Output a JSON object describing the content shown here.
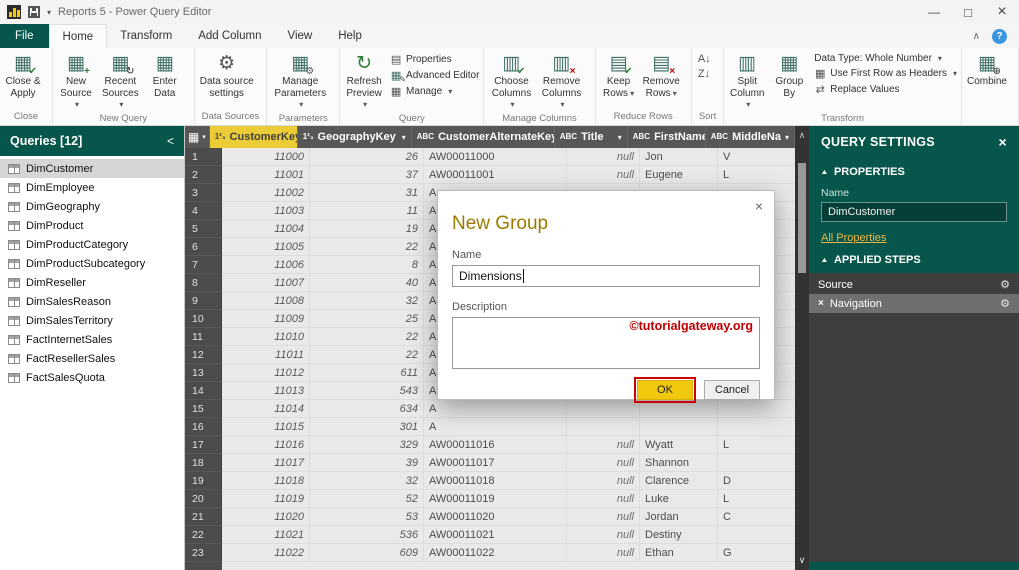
{
  "titlebar": {
    "title": "Reports 5 - Power Query Editor"
  },
  "tabs": [
    {
      "label": "File",
      "file": true
    },
    {
      "label": "Home",
      "active": true
    },
    {
      "label": "Transform"
    },
    {
      "label": "Add Column"
    },
    {
      "label": "View"
    },
    {
      "label": "Help"
    }
  ],
  "ribbon": {
    "groups": [
      {
        "caption": "Close",
        "big": [
          {
            "label1": "Close &",
            "label2": "Apply",
            "icon": "close-apply"
          }
        ]
      },
      {
        "caption": "New Query",
        "big": [
          {
            "label1": "New",
            "label2": "Source",
            "icon": "new-source",
            "dropdown": true
          },
          {
            "label1": "Recent",
            "label2": "Sources",
            "icon": "recent-sources",
            "dropdown": true
          },
          {
            "label1": "Enter",
            "label2": "Data",
            "icon": "enter-data"
          }
        ]
      },
      {
        "caption": "Data Sources",
        "big": [
          {
            "label1": "Data source",
            "label2": "settings",
            "icon": "datasource-settings"
          }
        ]
      },
      {
        "caption": "Parameters",
        "big": [
          {
            "label1": "Manage",
            "label2": "Parameters",
            "icon": "manage-parameters",
            "dropdown": true
          }
        ]
      },
      {
        "caption": "Query",
        "big": [
          {
            "label1": "Refresh",
            "label2": "Preview",
            "icon": "refresh",
            "dropdown": true
          }
        ],
        "small": [
          {
            "label": "Properties",
            "icon": "properties"
          },
          {
            "label": "Advanced Editor",
            "icon": "advanced-editor"
          },
          {
            "label": "Manage",
            "icon": "manage",
            "dropdown": true
          }
        ]
      },
      {
        "caption": "Manage Columns",
        "big": [
          {
            "label1": "Choose",
            "label2": "Columns",
            "icon": "choose-columns",
            "dropdown": true
          },
          {
            "label1": "Remove",
            "label2": "Columns",
            "icon": "remove-columns",
            "dropdown": true
          }
        ]
      },
      {
        "caption": "Reduce Rows",
        "big": [
          {
            "label1": "Keep",
            "label2": "Rows",
            "icon": "keep-rows",
            "dropdown": true
          },
          {
            "label1": "Remove",
            "label2": "Rows",
            "icon": "remove-rows",
            "dropdown": true
          }
        ]
      },
      {
        "caption": "Sort",
        "small": [
          {
            "label": "",
            "icon": "sort-az"
          },
          {
            "label": "",
            "icon": "sort-za"
          }
        ]
      },
      {
        "caption": "Transform",
        "big": [
          {
            "label1": "Split",
            "label2": "Column",
            "icon": "split-column",
            "dropdown": true
          },
          {
            "label1": "Group",
            "label2": "By",
            "icon": "group-by"
          }
        ],
        "small": [
          {
            "label": "Data Type: Whole Number",
            "dropdown": true
          },
          {
            "label": "Use First Row as Headers",
            "icon": "first-row-headers",
            "dropdown": true
          },
          {
            "label": "Replace Values",
            "icon": "replace-values"
          }
        ]
      },
      {
        "caption": "",
        "big": [
          {
            "label1": "Combine",
            "label2": "",
            "icon": "combine"
          }
        ]
      }
    ]
  },
  "queries": {
    "title": "Queries [12]",
    "items": [
      {
        "label": "DimCustomer",
        "selected": true
      },
      {
        "label": "DimEmployee"
      },
      {
        "label": "DimGeography"
      },
      {
        "label": "DimProduct"
      },
      {
        "label": "DimProductCategory"
      },
      {
        "label": "DimProductSubcategory"
      },
      {
        "label": "DimReseller"
      },
      {
        "label": "DimSalesReason"
      },
      {
        "label": "DimSalesTerritory"
      },
      {
        "label": "FactInternetSales"
      },
      {
        "label": "FactResellerSales"
      },
      {
        "label": "FactSalesQuota"
      }
    ]
  },
  "table": {
    "columns": [
      {
        "name": "CustomerKey",
        "type": "number",
        "selected": true
      },
      {
        "name": "GeographyKey",
        "type": "number"
      },
      {
        "name": "CustomerAlternateKey",
        "type": "text"
      },
      {
        "name": "Title",
        "type": "text"
      },
      {
        "name": "FirstName",
        "type": "text"
      },
      {
        "name": "MiddleNa",
        "type": "text"
      }
    ],
    "rows": [
      {
        "n": "1",
        "key": "11000",
        "geo": "26",
        "alt": "AW00011000",
        "title": "null",
        "first": "Jon",
        "middle": "V"
      },
      {
        "n": "2",
        "key": "11001",
        "geo": "37",
        "alt": "AW00011001",
        "title": "null",
        "first": "Eugene",
        "middle": "L"
      },
      {
        "n": "3",
        "key": "11002",
        "geo": "31",
        "alt": "A"
      },
      {
        "n": "4",
        "key": "11003",
        "geo": "11",
        "alt": "A"
      },
      {
        "n": "5",
        "key": "11004",
        "geo": "19",
        "alt": "A"
      },
      {
        "n": "6",
        "key": "11005",
        "geo": "22",
        "alt": "A"
      },
      {
        "n": "7",
        "key": "11006",
        "geo": "8",
        "alt": "A"
      },
      {
        "n": "8",
        "key": "11007",
        "geo": "40",
        "alt": "A"
      },
      {
        "n": "9",
        "key": "11008",
        "geo": "32",
        "alt": "A"
      },
      {
        "n": "10",
        "key": "11009",
        "geo": "25",
        "alt": "A"
      },
      {
        "n": "11",
        "key": "11010",
        "geo": "22",
        "alt": "A"
      },
      {
        "n": "12",
        "key": "11011",
        "geo": "22",
        "alt": "A"
      },
      {
        "n": "13",
        "key": "11012",
        "geo": "611",
        "alt": "A"
      },
      {
        "n": "14",
        "key": "11013",
        "geo": "543",
        "alt": "A"
      },
      {
        "n": "15",
        "key": "11014",
        "geo": "634",
        "alt": "A"
      },
      {
        "n": "16",
        "key": "11015",
        "geo": "301",
        "alt": "A"
      },
      {
        "n": "17",
        "key": "11016",
        "geo": "329",
        "alt": "AW00011016",
        "title": "null",
        "first": "Wyatt",
        "middle": "L"
      },
      {
        "n": "18",
        "key": "11017",
        "geo": "39",
        "alt": "AW00011017",
        "title": "null",
        "first": "Shannon",
        "middle": ""
      },
      {
        "n": "19",
        "key": "11018",
        "geo": "32",
        "alt": "AW00011018",
        "title": "null",
        "first": "Clarence",
        "middle": "D"
      },
      {
        "n": "20",
        "key": "11019",
        "geo": "52",
        "alt": "AW00011019",
        "title": "null",
        "first": "Luke",
        "middle": "L"
      },
      {
        "n": "21",
        "key": "11020",
        "geo": "53",
        "alt": "AW00011020",
        "title": "null",
        "first": "Jordan",
        "middle": "C"
      },
      {
        "n": "22",
        "key": "11021",
        "geo": "536",
        "alt": "AW00011021",
        "title": "null",
        "first": "Destiny",
        "middle": ""
      },
      {
        "n": "23",
        "key": "11022",
        "geo": "609",
        "alt": "AW00011022",
        "title": "null",
        "first": "Ethan",
        "middle": "G"
      }
    ]
  },
  "dialog": {
    "title": "New Group",
    "name_label": "Name",
    "name_value": "Dimensions",
    "description_label": "Description",
    "watermark": "©tutorialgateway.org",
    "ok_label": "OK",
    "cancel_label": "Cancel"
  },
  "query_settings": {
    "title": "QUERY SETTINGS",
    "properties_label": "PROPERTIES",
    "name_label": "Name",
    "name_value": "DimCustomer",
    "all_properties_label": "All Properties",
    "applied_steps_label": "APPLIED STEPS",
    "steps": [
      {
        "label": "Source"
      },
      {
        "label": "Navigation",
        "selected": true,
        "deletable": true
      }
    ]
  }
}
